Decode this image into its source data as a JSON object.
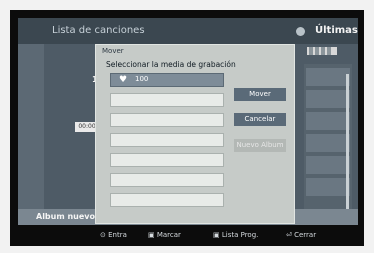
{
  "screen": {
    "title": "Lista de canciones",
    "top_right": "Últimas",
    "left_tag": "100",
    "small_box": "00:00"
  },
  "dialog": {
    "heading": "Mover",
    "instruction": "Seleccionar la media de grabación",
    "items": [
      {
        "label": "100",
        "selected": true
      },
      {
        "label": "",
        "selected": false
      },
      {
        "label": "",
        "selected": false
      },
      {
        "label": "",
        "selected": false
      },
      {
        "label": "",
        "selected": false
      },
      {
        "label": "",
        "selected": false
      },
      {
        "label": "",
        "selected": false
      },
      {
        "label": "",
        "selected": false
      }
    ],
    "buttons": {
      "move": "Mover",
      "cancel": "Cancelar",
      "disabled": "Nuevo Album"
    }
  },
  "album_bar": {
    "label": "Album nuevo"
  },
  "footer": {
    "entry": "Entra",
    "select": "Marcar",
    "prog": "Lista Prog.",
    "close": "Cerrar"
  }
}
